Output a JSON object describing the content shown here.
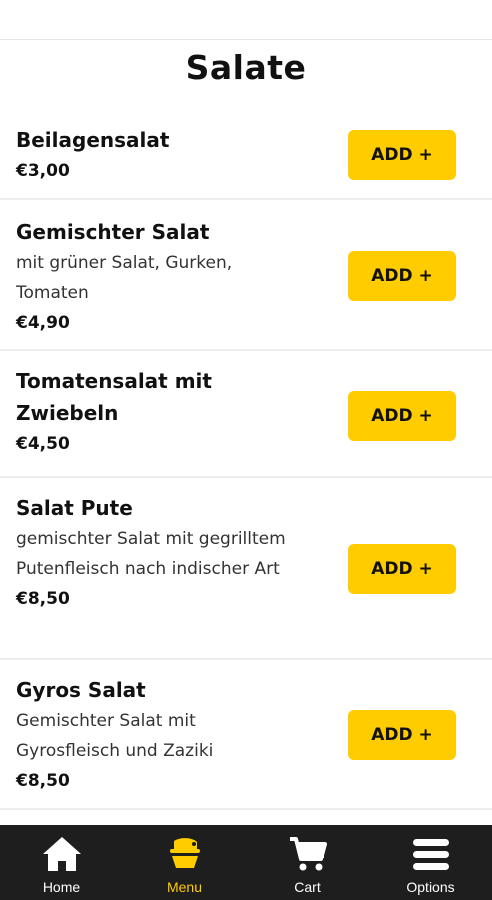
{
  "section": {
    "title": "Salate"
  },
  "items": [
    {
      "name": "Beilagensalat",
      "description": "",
      "price": "€3,00",
      "button": "ADD +"
    },
    {
      "name": "Gemischter Salat",
      "description": "mit grüner Salat, Gurken, Tomaten",
      "price": "€4,90",
      "button": "ADD +"
    },
    {
      "name": "Tomatensalat mit Zwiebeln",
      "description": "",
      "price": "€4,50",
      "button": "ADD +"
    },
    {
      "name": "Salat Pute",
      "description": "gemischter Salat mit gegrilltem Putenfleisch nach indischer Art",
      "price": "€8,50",
      "button": "ADD +"
    },
    {
      "name": "Gyros Salat",
      "description": "Gemischter Salat mit Gyrosfleisch und Zaziki",
      "price": "€8,50",
      "button": "ADD +"
    }
  ],
  "nav": {
    "home": {
      "label": "Home",
      "icon": "home-icon"
    },
    "menu": {
      "label": "Menu",
      "icon": "menu-food-icon"
    },
    "cart": {
      "label": "Cart",
      "icon": "cart-icon"
    },
    "options": {
      "label": "Options",
      "icon": "options-icon"
    }
  },
  "colors": {
    "accent": "#ffcc00",
    "nav_background": "#1e1e1e",
    "text": "#111111"
  }
}
